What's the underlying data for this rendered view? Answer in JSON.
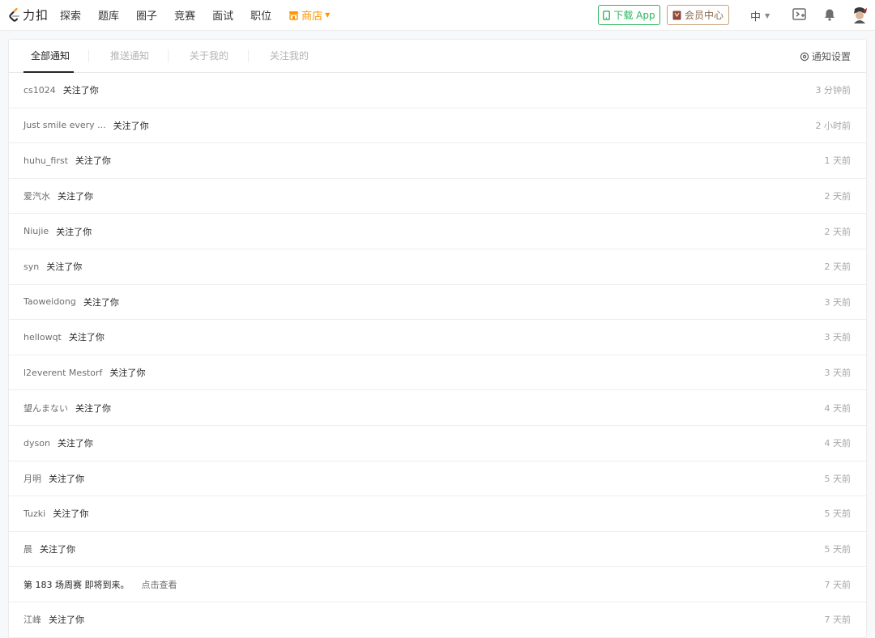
{
  "header": {
    "logo_text": "力扣",
    "nav": [
      "探索",
      "题库",
      "圈子",
      "竞赛",
      "面试",
      "职位"
    ],
    "shop_label": "商店",
    "download_label": "下载 App",
    "member_label": "会员中心",
    "lang_label": "中",
    "colors": {
      "brand_green": "#2db55d",
      "shop_orange": "#ff9500",
      "member_gold": "#c9a27a"
    }
  },
  "tabs": {
    "items": [
      "全部通知",
      "推送通知",
      "关于我的",
      "关注我的"
    ],
    "active_index": 0,
    "settings_label": "通知设置"
  },
  "notifications": [
    {
      "who": "cs1024",
      "action": "关注了你",
      "link": "",
      "time": "3 分钟前"
    },
    {
      "who": "Just smile every ...",
      "action": "关注了你",
      "link": "",
      "time": "2 小时前"
    },
    {
      "who": "huhu_first",
      "action": "关注了你",
      "link": "",
      "time": "1 天前"
    },
    {
      "who": "爱汽水",
      "action": "关注了你",
      "link": "",
      "time": "2 天前"
    },
    {
      "who": "Niujie",
      "action": "关注了你",
      "link": "",
      "time": "2 天前"
    },
    {
      "who": "syn",
      "action": "关注了你",
      "link": "",
      "time": "2 天前"
    },
    {
      "who": "Taoweidong",
      "action": "关注了你",
      "link": "",
      "time": "3 天前"
    },
    {
      "who": "hellowqt",
      "action": "关注了你",
      "link": "",
      "time": "3 天前"
    },
    {
      "who": "l2everent Mestorf",
      "action": "关注了你",
      "link": "",
      "time": "3 天前"
    },
    {
      "who": "望んまない",
      "action": "关注了你",
      "link": "",
      "time": "4 天前"
    },
    {
      "who": "dyson",
      "action": "关注了你",
      "link": "",
      "time": "4 天前"
    },
    {
      "who": "月明",
      "action": "关注了你",
      "link": "",
      "time": "5 天前"
    },
    {
      "who": "Tuzki",
      "action": "关注了你",
      "link": "",
      "time": "5 天前"
    },
    {
      "who": "晨",
      "action": "关注了你",
      "link": "",
      "time": "5 天前"
    },
    {
      "who": "",
      "action": "第 183 场周赛 即将到来。",
      "link": "点击查看",
      "time": "7 天前"
    },
    {
      "who": "江峰",
      "action": "关注了你",
      "link": "",
      "time": "7 天前"
    }
  ]
}
